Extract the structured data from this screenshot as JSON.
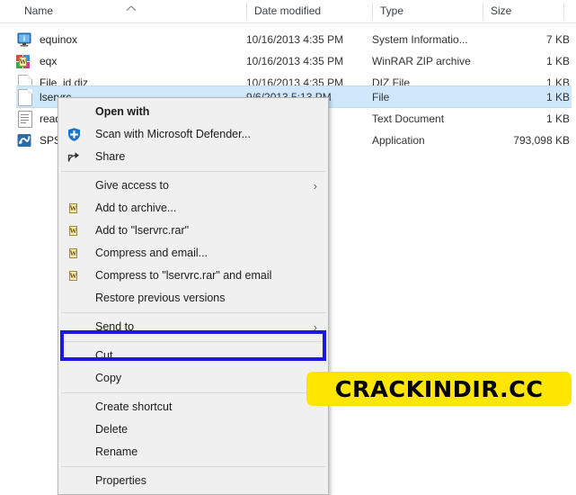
{
  "explorer": {
    "columns": [
      {
        "label": "Name",
        "icon": "sort-ascending-chevron-icon"
      },
      {
        "label": "Date modified",
        "icon": ""
      },
      {
        "label": "Type",
        "icon": ""
      },
      {
        "label": "Size",
        "icon": ""
      }
    ],
    "rows": [
      {
        "name": "equinox",
        "date": "10/16/2013 4:35 PM",
        "type": "System Informatio...",
        "size": "7 KB",
        "icon": "system-information-icon",
        "selected": false
      },
      {
        "name": "eqx",
        "date": "10/16/2013 4:35 PM",
        "type": "WinRAR ZIP archive",
        "size": "1 KB",
        "icon": "winrar-archive-icon",
        "selected": false
      },
      {
        "name": "File_id.diz",
        "date": "10/16/2013 4:35 PM",
        "type": "DIZ File",
        "size": "1 KB",
        "icon": "blank-file-icon",
        "selected": false
      },
      {
        "name": "lservrc",
        "date": "9/6/2013 5:13 PM",
        "type": "File",
        "size": "1 KB",
        "icon": "blank-file-icon",
        "selected": true
      },
      {
        "name": "read",
        "date": "",
        "type": "Text Document",
        "size": "1 KB",
        "icon": "text-document-icon",
        "selected": false
      },
      {
        "name": "SPSS",
        "date": "",
        "type": "Application",
        "size": "793,098 KB",
        "icon": "spss-application-icon",
        "selected": false
      }
    ],
    "selection_color": "#cfe8fb"
  },
  "context_menu": {
    "items": [
      {
        "label": "Open with",
        "icon": "",
        "bold": true,
        "arrow": false,
        "sep_after": false
      },
      {
        "label": "Scan with Microsoft Defender...",
        "icon": "defender-shield-icon",
        "bold": false,
        "arrow": false,
        "sep_after": false
      },
      {
        "label": "Share",
        "icon": "share-icon",
        "bold": false,
        "arrow": false,
        "sep_after": true
      },
      {
        "label": "Give access to",
        "icon": "",
        "bold": false,
        "arrow": true,
        "sep_after": false
      },
      {
        "label": "Add to archive...",
        "icon": "winrar-icon",
        "bold": false,
        "arrow": false,
        "sep_after": false
      },
      {
        "label": "Add to \"lservrc.rar\"",
        "icon": "winrar-icon",
        "bold": false,
        "arrow": false,
        "sep_after": false
      },
      {
        "label": "Compress and email...",
        "icon": "winrar-icon",
        "bold": false,
        "arrow": false,
        "sep_after": false
      },
      {
        "label": "Compress to \"lservrc.rar\" and email",
        "icon": "winrar-icon",
        "bold": false,
        "arrow": false,
        "sep_after": false
      },
      {
        "label": "Restore previous versions",
        "icon": "",
        "bold": false,
        "arrow": false,
        "sep_after": true
      },
      {
        "label": "Send to",
        "icon": "",
        "bold": false,
        "arrow": true,
        "sep_after": true
      },
      {
        "label": "Cut",
        "icon": "",
        "bold": false,
        "arrow": false,
        "sep_after": false
      },
      {
        "label": "Copy",
        "icon": "",
        "bold": false,
        "arrow": false,
        "sep_after": true
      },
      {
        "label": "Create shortcut",
        "icon": "",
        "bold": false,
        "arrow": false,
        "sep_after": false
      },
      {
        "label": "Delete",
        "icon": "",
        "bold": false,
        "arrow": false,
        "sep_after": false
      },
      {
        "label": "Rename",
        "icon": "",
        "bold": false,
        "arrow": false,
        "sep_after": true
      },
      {
        "label": "Properties",
        "icon": "",
        "bold": false,
        "arrow": false,
        "sep_after": false
      }
    ],
    "background": "#f0f0f0",
    "submenu_arrow_glyph": "›"
  },
  "highlight": {
    "target_label": "Copy",
    "color": "#1c18e0"
  },
  "watermark": {
    "text": "CRACKINDIR.CC",
    "background": "#ffe600",
    "color": "#000000"
  }
}
